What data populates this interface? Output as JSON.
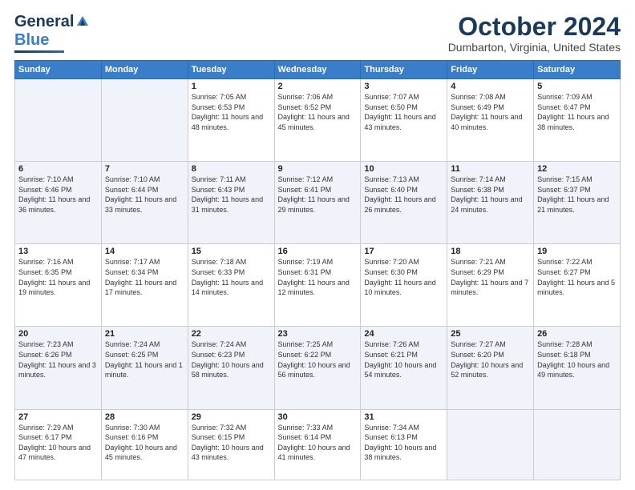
{
  "logo": {
    "part1": "General",
    "part2": "Blue"
  },
  "header": {
    "month": "October 2024",
    "location": "Dumbarton, Virginia, United States"
  },
  "days_of_week": [
    "Sunday",
    "Monday",
    "Tuesday",
    "Wednesday",
    "Thursday",
    "Friday",
    "Saturday"
  ],
  "weeks": [
    [
      {
        "day": "",
        "empty": true
      },
      {
        "day": "",
        "empty": true
      },
      {
        "day": "1",
        "sunrise": "Sunrise: 7:05 AM",
        "sunset": "Sunset: 6:53 PM",
        "daylight": "Daylight: 11 hours and 48 minutes."
      },
      {
        "day": "2",
        "sunrise": "Sunrise: 7:06 AM",
        "sunset": "Sunset: 6:52 PM",
        "daylight": "Daylight: 11 hours and 45 minutes."
      },
      {
        "day": "3",
        "sunrise": "Sunrise: 7:07 AM",
        "sunset": "Sunset: 6:50 PM",
        "daylight": "Daylight: 11 hours and 43 minutes."
      },
      {
        "day": "4",
        "sunrise": "Sunrise: 7:08 AM",
        "sunset": "Sunset: 6:49 PM",
        "daylight": "Daylight: 11 hours and 40 minutes."
      },
      {
        "day": "5",
        "sunrise": "Sunrise: 7:09 AM",
        "sunset": "Sunset: 6:47 PM",
        "daylight": "Daylight: 11 hours and 38 minutes."
      }
    ],
    [
      {
        "day": "6",
        "sunrise": "Sunrise: 7:10 AM",
        "sunset": "Sunset: 6:46 PM",
        "daylight": "Daylight: 11 hours and 36 minutes."
      },
      {
        "day": "7",
        "sunrise": "Sunrise: 7:10 AM",
        "sunset": "Sunset: 6:44 PM",
        "daylight": "Daylight: 11 hours and 33 minutes."
      },
      {
        "day": "8",
        "sunrise": "Sunrise: 7:11 AM",
        "sunset": "Sunset: 6:43 PM",
        "daylight": "Daylight: 11 hours and 31 minutes."
      },
      {
        "day": "9",
        "sunrise": "Sunrise: 7:12 AM",
        "sunset": "Sunset: 6:41 PM",
        "daylight": "Daylight: 11 hours and 29 minutes."
      },
      {
        "day": "10",
        "sunrise": "Sunrise: 7:13 AM",
        "sunset": "Sunset: 6:40 PM",
        "daylight": "Daylight: 11 hours and 26 minutes."
      },
      {
        "day": "11",
        "sunrise": "Sunrise: 7:14 AM",
        "sunset": "Sunset: 6:38 PM",
        "daylight": "Daylight: 11 hours and 24 minutes."
      },
      {
        "day": "12",
        "sunrise": "Sunrise: 7:15 AM",
        "sunset": "Sunset: 6:37 PM",
        "daylight": "Daylight: 11 hours and 21 minutes."
      }
    ],
    [
      {
        "day": "13",
        "sunrise": "Sunrise: 7:16 AM",
        "sunset": "Sunset: 6:35 PM",
        "daylight": "Daylight: 11 hours and 19 minutes."
      },
      {
        "day": "14",
        "sunrise": "Sunrise: 7:17 AM",
        "sunset": "Sunset: 6:34 PM",
        "daylight": "Daylight: 11 hours and 17 minutes."
      },
      {
        "day": "15",
        "sunrise": "Sunrise: 7:18 AM",
        "sunset": "Sunset: 6:33 PM",
        "daylight": "Daylight: 11 hours and 14 minutes."
      },
      {
        "day": "16",
        "sunrise": "Sunrise: 7:19 AM",
        "sunset": "Sunset: 6:31 PM",
        "daylight": "Daylight: 11 hours and 12 minutes."
      },
      {
        "day": "17",
        "sunrise": "Sunrise: 7:20 AM",
        "sunset": "Sunset: 6:30 PM",
        "daylight": "Daylight: 11 hours and 10 minutes."
      },
      {
        "day": "18",
        "sunrise": "Sunrise: 7:21 AM",
        "sunset": "Sunset: 6:29 PM",
        "daylight": "Daylight: 11 hours and 7 minutes."
      },
      {
        "day": "19",
        "sunrise": "Sunrise: 7:22 AM",
        "sunset": "Sunset: 6:27 PM",
        "daylight": "Daylight: 11 hours and 5 minutes."
      }
    ],
    [
      {
        "day": "20",
        "sunrise": "Sunrise: 7:23 AM",
        "sunset": "Sunset: 6:26 PM",
        "daylight": "Daylight: 11 hours and 3 minutes."
      },
      {
        "day": "21",
        "sunrise": "Sunrise: 7:24 AM",
        "sunset": "Sunset: 6:25 PM",
        "daylight": "Daylight: 11 hours and 1 minute."
      },
      {
        "day": "22",
        "sunrise": "Sunrise: 7:24 AM",
        "sunset": "Sunset: 6:23 PM",
        "daylight": "Daylight: 10 hours and 58 minutes."
      },
      {
        "day": "23",
        "sunrise": "Sunrise: 7:25 AM",
        "sunset": "Sunset: 6:22 PM",
        "daylight": "Daylight: 10 hours and 56 minutes."
      },
      {
        "day": "24",
        "sunrise": "Sunrise: 7:26 AM",
        "sunset": "Sunset: 6:21 PM",
        "daylight": "Daylight: 10 hours and 54 minutes."
      },
      {
        "day": "25",
        "sunrise": "Sunrise: 7:27 AM",
        "sunset": "Sunset: 6:20 PM",
        "daylight": "Daylight: 10 hours and 52 minutes."
      },
      {
        "day": "26",
        "sunrise": "Sunrise: 7:28 AM",
        "sunset": "Sunset: 6:18 PM",
        "daylight": "Daylight: 10 hours and 49 minutes."
      }
    ],
    [
      {
        "day": "27",
        "sunrise": "Sunrise: 7:29 AM",
        "sunset": "Sunset: 6:17 PM",
        "daylight": "Daylight: 10 hours and 47 minutes."
      },
      {
        "day": "28",
        "sunrise": "Sunrise: 7:30 AM",
        "sunset": "Sunset: 6:16 PM",
        "daylight": "Daylight: 10 hours and 45 minutes."
      },
      {
        "day": "29",
        "sunrise": "Sunrise: 7:32 AM",
        "sunset": "Sunset: 6:15 PM",
        "daylight": "Daylight: 10 hours and 43 minutes."
      },
      {
        "day": "30",
        "sunrise": "Sunrise: 7:33 AM",
        "sunset": "Sunset: 6:14 PM",
        "daylight": "Daylight: 10 hours and 41 minutes."
      },
      {
        "day": "31",
        "sunrise": "Sunrise: 7:34 AM",
        "sunset": "Sunset: 6:13 PM",
        "daylight": "Daylight: 10 hours and 38 minutes."
      },
      {
        "day": "",
        "empty": true
      },
      {
        "day": "",
        "empty": true
      }
    ]
  ]
}
